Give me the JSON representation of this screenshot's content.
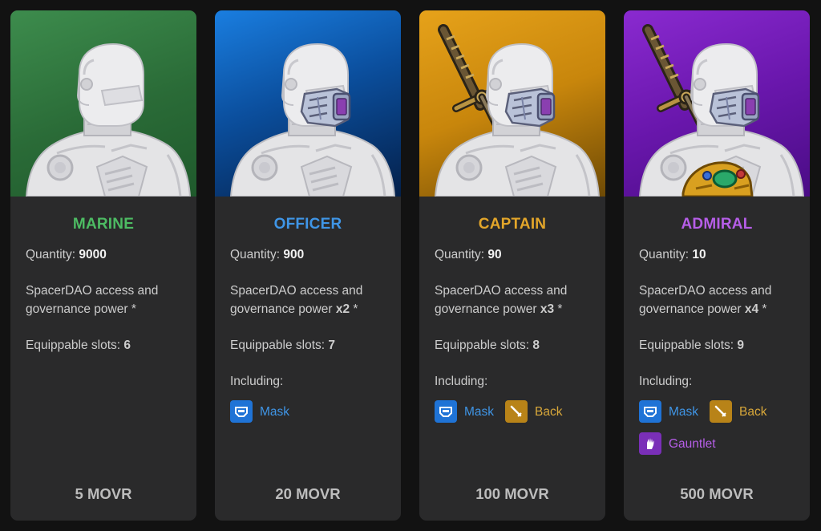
{
  "cards": [
    {
      "title": "MARINE",
      "quantity_label": "Quantity: ",
      "quantity": "9000",
      "access_text": "SpacerDAO access and governance power",
      "multiplier": "",
      "asterisk": " *",
      "slots_label": "Equippable slots: ",
      "slots": "6",
      "including_label": "",
      "items": [],
      "price": "5 MOVR"
    },
    {
      "title": "OFFICER",
      "quantity_label": "Quantity: ",
      "quantity": "900",
      "access_text": "SpacerDAO access and governance power ",
      "multiplier": "x2",
      "asterisk": " *",
      "slots_label": "Equippable slots: ",
      "slots": "7",
      "including_label": "Including:",
      "items": [
        {
          "label": "Mask",
          "icon": "mask-icon"
        }
      ],
      "price": "20 MOVR"
    },
    {
      "title": "CAPTAIN",
      "quantity_label": "Quantity: ",
      "quantity": "90",
      "access_text": "SpacerDAO access and governance power ",
      "multiplier": "x3",
      "asterisk": " *",
      "slots_label": "Equippable slots: ",
      "slots": "8",
      "including_label": "Including:",
      "items": [
        {
          "label": "Mask",
          "icon": "mask-icon"
        },
        {
          "label": "Back",
          "icon": "sword-icon"
        }
      ],
      "price": "100 MOVR"
    },
    {
      "title": "ADMIRAL",
      "quantity_label": "Quantity: ",
      "quantity": "10",
      "access_text": "SpacerDAO access and governance power ",
      "multiplier": "x4",
      "asterisk": " *",
      "slots_label": "Equippable slots: ",
      "slots": "9",
      "including_label": "Including:",
      "items": [
        {
          "label": "Mask",
          "icon": "mask-icon"
        },
        {
          "label": "Back",
          "icon": "sword-icon"
        },
        {
          "label": "Gauntlet",
          "icon": "gauntlet-icon"
        }
      ],
      "price": "500 MOVR"
    }
  ],
  "colors": {
    "marine": "#4dbb63",
    "officer": "#3f95e6",
    "captain": "#e3a62a",
    "admiral": "#b65ee8",
    "card_bg": "#2a2a2b",
    "page_bg": "#121212"
  }
}
